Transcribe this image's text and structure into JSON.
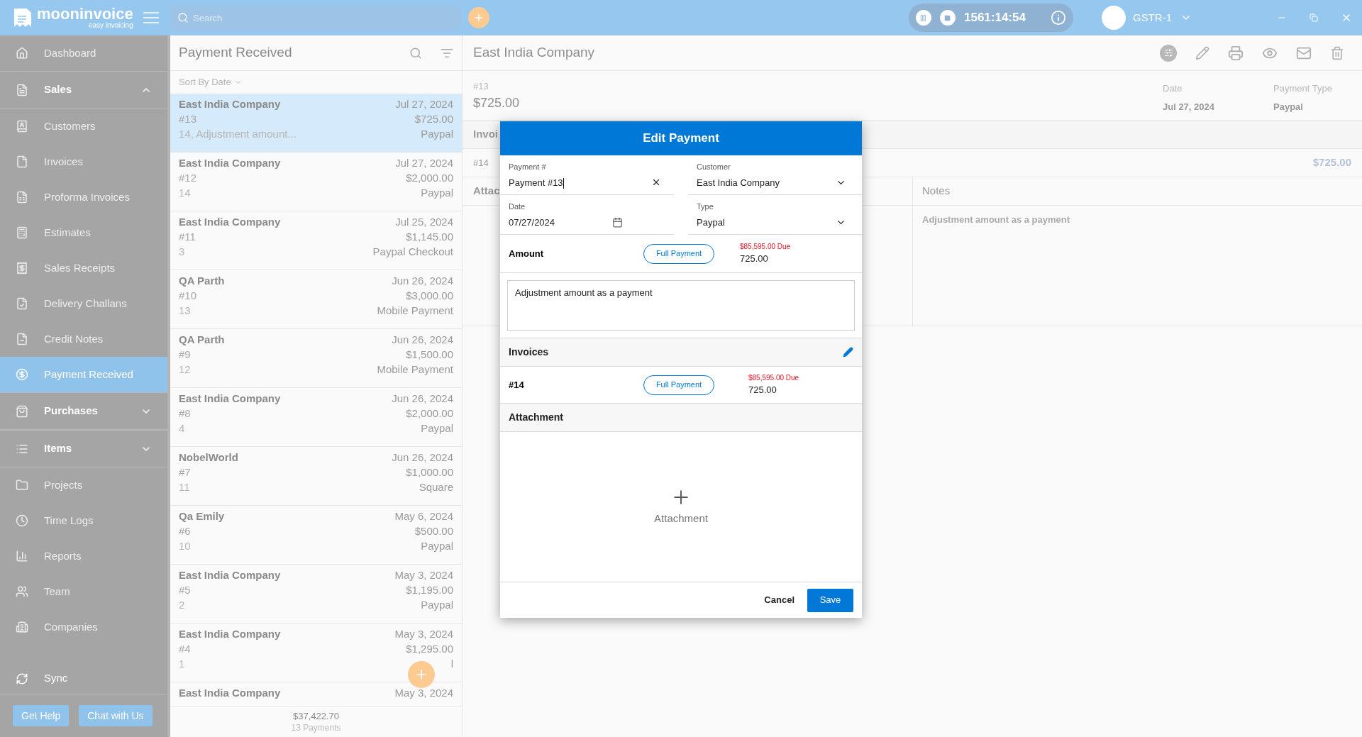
{
  "topbar": {
    "app_name": "mooninvoice",
    "tagline": "easy invoicing",
    "search": {
      "placeholder": "Search"
    },
    "timer": "1561:14:54",
    "company": "GSTR-1"
  },
  "sidebar": {
    "items": [
      {
        "kind": "item",
        "label": "Dashboard",
        "selected": false
      },
      {
        "kind": "section",
        "label": "Sales",
        "expanded": true
      },
      {
        "kind": "item",
        "label": "Customers",
        "selected": false
      },
      {
        "kind": "item",
        "label": "Invoices",
        "selected": false
      },
      {
        "kind": "item",
        "label": "Proforma Invoices",
        "selected": false
      },
      {
        "kind": "item",
        "label": "Estimates",
        "selected": false
      },
      {
        "kind": "item",
        "label": "Sales Receipts",
        "selected": false
      },
      {
        "kind": "item",
        "label": "Delivery Challans",
        "selected": false
      },
      {
        "kind": "item",
        "label": "Credit Notes",
        "selected": false
      },
      {
        "kind": "item",
        "label": "Payment Received",
        "selected": true
      },
      {
        "kind": "section",
        "label": "Purchases",
        "expanded": false
      },
      {
        "kind": "section",
        "label": "Items",
        "expanded": false
      },
      {
        "kind": "item",
        "label": "Projects",
        "selected": false
      },
      {
        "kind": "item",
        "label": "Time Logs",
        "selected": false
      },
      {
        "kind": "item",
        "label": "Reports",
        "selected": false
      },
      {
        "kind": "item",
        "label": "Team",
        "selected": false
      },
      {
        "kind": "item",
        "label": "Companies",
        "selected": false
      }
    ],
    "sync": "Sync",
    "buttons": [
      "Get Help",
      "Chat with Us"
    ]
  },
  "list": {
    "title": "Payment Received",
    "sort": "Sort By Date",
    "rows": [
      {
        "name": "East India Company",
        "date": "Jul 27, 2024",
        "number": "#13",
        "amount": "$725.00",
        "ref": "14, Adjustment amount...",
        "type": "Paypal",
        "selected": true
      },
      {
        "name": "East India Company",
        "date": "Jul 27, 2024",
        "number": "#12",
        "amount": "$2,000.00",
        "ref": "14",
        "type": "Paypal",
        "selected": false
      },
      {
        "name": "East India Company",
        "date": "Jul 25, 2024",
        "number": "#11",
        "amount": "$1,145.00",
        "ref": "3",
        "type": "Paypal Checkout",
        "selected": false
      },
      {
        "name": "QA Parth",
        "date": "Jun 26, 2024",
        "number": "#10",
        "amount": "$3,000.00",
        "ref": "13",
        "type": "Mobile Payment",
        "selected": false
      },
      {
        "name": "QA Parth",
        "date": "Jun 26, 2024",
        "number": "#9",
        "amount": "$1,500.00",
        "ref": "12",
        "type": "Mobile Payment",
        "selected": false
      },
      {
        "name": "East India Company",
        "date": "Jun 26, 2024",
        "number": "#8",
        "amount": "$2,000.00",
        "ref": "4",
        "type": "Paypal",
        "selected": false
      },
      {
        "name": "NobelWorld",
        "date": "Jun 26, 2024",
        "number": "#7",
        "amount": "$1,000.00",
        "ref": "11",
        "type": "Square",
        "selected": false
      },
      {
        "name": "Qa Emily",
        "date": "May 6, 2024",
        "number": "#6",
        "amount": "$500.00",
        "ref": "10",
        "type": "Paypal",
        "selected": false
      },
      {
        "name": "East India Company",
        "date": "May 3, 2024",
        "number": "#5",
        "amount": "$1,195.00",
        "ref": "2",
        "type": "Paypal",
        "selected": false
      },
      {
        "name": "East India Company",
        "date": "May 3, 2024",
        "number": "#4",
        "amount": "$1,295.00",
        "ref": "1",
        "type": "l",
        "selected": false
      },
      {
        "name": "East India Company",
        "date": "May 3, 2024",
        "selected": false
      }
    ],
    "total": "$37,422.70",
    "count": "13 Payments"
  },
  "detail": {
    "title": "East India Company",
    "number": "#13",
    "amount": "$725.00",
    "date_label": "Date",
    "date": "Jul 27, 2024",
    "type_label": "Payment Type",
    "type": "Paypal",
    "invoices_label": "Invoi",
    "invoice_number": "#14",
    "invoice_amount": "$725.00",
    "attachment_label": "Attac",
    "notes_label": "Notes",
    "notes": "Adjustment amount as a payment"
  },
  "dialog": {
    "title": "Edit Payment",
    "fields": [
      {
        "kind": "text",
        "label": "Payment #",
        "value": "Payment #13"
      },
      {
        "kind": "select",
        "label": "Customer",
        "value": "East India Company"
      },
      {
        "kind": "date",
        "label": "Date",
        "value": "07/27/2024"
      },
      {
        "kind": "select",
        "label": "Type",
        "value": "Paypal"
      }
    ],
    "amount": {
      "label": "Amount",
      "button": "Full Payment",
      "due": "$85,595.00 Due",
      "value": "725.00"
    },
    "notes": "Adjustment amount as a payment",
    "invoices_label": "Invoices",
    "invoices": [
      {
        "number": "#14",
        "button": "Full Payment",
        "due": "$85,595.00 Due",
        "value": "725.00"
      }
    ],
    "attachment_label": "Attachment",
    "attachment_add": "Attachment",
    "buttons": {
      "cancel": "Cancel",
      "save": "Save"
    }
  }
}
